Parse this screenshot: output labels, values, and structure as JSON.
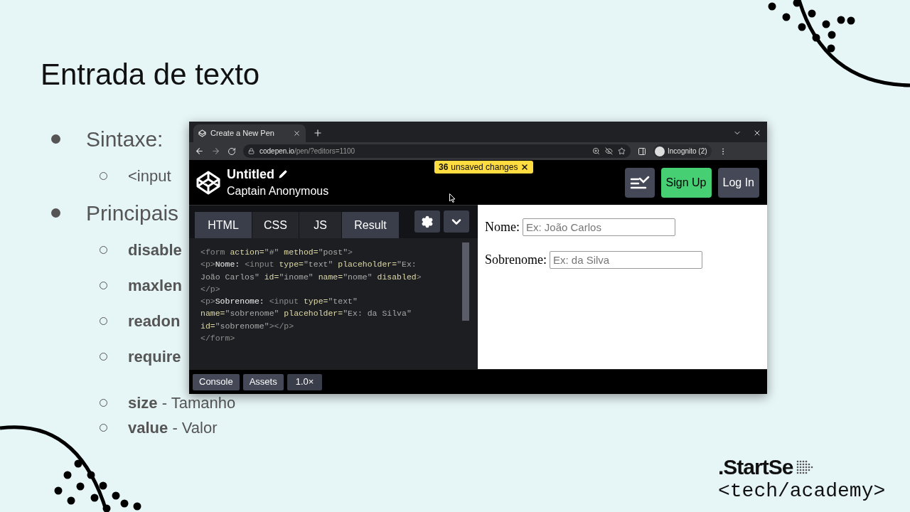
{
  "slide": {
    "title": "Entrada de texto",
    "bullets": [
      {
        "text": "Sintaxe:",
        "children": [
          {
            "kind": "plain",
            "text": "<input"
          }
        ]
      },
      {
        "text": "Principais",
        "children": [
          {
            "kind": "attribute",
            "term": "disable"
          },
          {
            "kind": "attribute",
            "term": "maxlen"
          },
          {
            "kind": "attribute",
            "term": "readon"
          },
          {
            "kind": "attribute",
            "term": "require"
          },
          {
            "kind": "attribute",
            "term": "size",
            "description": "- Tamanho"
          },
          {
            "kind": "attribute",
            "term": "value",
            "description": "- Valor"
          }
        ]
      }
    ],
    "brand": ".StartSe",
    "tagline": "<tech/academy>"
  },
  "browser": {
    "tab_title": "Create a New Pen",
    "url_host": "codepen.io",
    "url_path": "/pen/?editors=1100",
    "profile": "Incognito (2)"
  },
  "codepen": {
    "title": "Untitled",
    "author": "Captain Anonymous",
    "unsaved_count": "36",
    "unsaved_label": "unsaved changes",
    "buttons": [
      "Sign Up",
      "Log In"
    ],
    "tabs": [
      {
        "label": "HTML",
        "selected": true
      },
      {
        "label": "CSS",
        "selected": false
      },
      {
        "label": "JS",
        "selected": false
      },
      {
        "label": "Result",
        "selected": true
      }
    ],
    "code_lines": [
      [
        {
          "kind": "tag",
          "text": "<form "
        },
        {
          "kind": "attr",
          "text": "action="
        },
        {
          "kind": "value",
          "text": "\"#\" "
        },
        {
          "kind": "attr",
          "text": "method="
        },
        {
          "kind": "value",
          "text": "\"post\""
        },
        {
          "kind": "tag",
          "text": ">"
        }
      ],
      [
        {
          "kind": "tag",
          "text": "<p>"
        },
        {
          "kind": "text",
          "text": "Nome: "
        },
        {
          "kind": "tag",
          "text": "<input "
        },
        {
          "kind": "attr",
          "text": "type="
        },
        {
          "kind": "value",
          "text": "\"text\" "
        },
        {
          "kind": "attr",
          "text": "placeholder="
        },
        {
          "kind": "value",
          "text": "\"Ex:"
        }
      ],
      [
        {
          "kind": "value",
          "text": "João Carlos\" "
        },
        {
          "kind": "attr",
          "text": "id="
        },
        {
          "kind": "value",
          "text": "\"inome\" "
        },
        {
          "kind": "attr",
          "text": "name="
        },
        {
          "kind": "value",
          "text": "\"nome\" "
        },
        {
          "kind": "attr",
          "text": "disabled"
        },
        {
          "kind": "tag",
          "text": ">"
        }
      ],
      [
        {
          "kind": "tag",
          "text": "</p>"
        }
      ],
      [
        {
          "kind": "tag",
          "text": "<p>"
        },
        {
          "kind": "text",
          "text": "Sobrenome: "
        },
        {
          "kind": "tag",
          "text": "<input "
        },
        {
          "kind": "attr",
          "text": "type="
        },
        {
          "kind": "value",
          "text": "\"text\""
        }
      ],
      [
        {
          "kind": "attr",
          "text": "name="
        },
        {
          "kind": "value",
          "text": "\"sobrenome\" "
        },
        {
          "kind": "attr",
          "text": "placeholder="
        },
        {
          "kind": "value",
          "text": "\"Ex: da Silva\""
        }
      ],
      [
        {
          "kind": "attr",
          "text": "id="
        },
        {
          "kind": "value",
          "text": "\"sobrenome\""
        },
        {
          "kind": "tag",
          "text": "></p>"
        }
      ],
      [
        {
          "kind": "tag",
          "text": "</form>"
        }
      ]
    ],
    "preview_fields": [
      {
        "label": "Nome:",
        "placeholder": "Ex: João Carlos"
      },
      {
        "label": "Sobrenome:",
        "placeholder": "Ex: da Silva"
      }
    ],
    "footer_buttons": [
      "Console",
      "Assets",
      "1.0×"
    ]
  }
}
